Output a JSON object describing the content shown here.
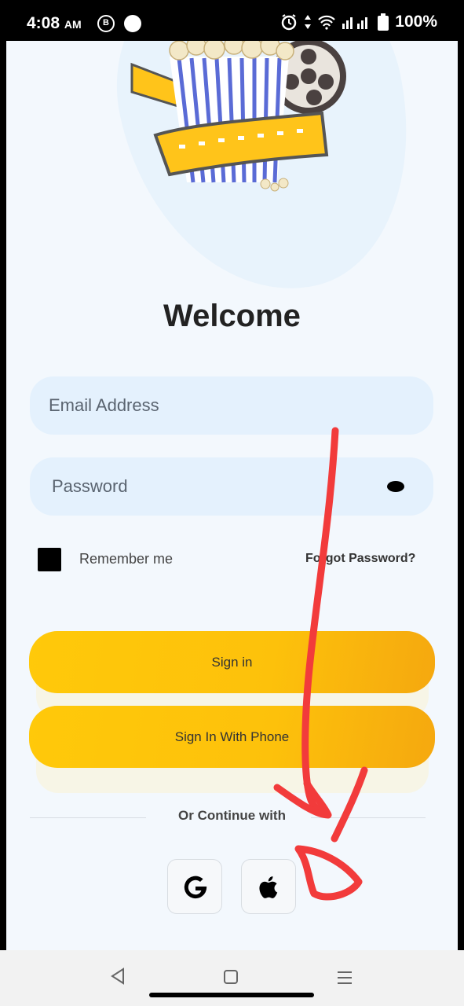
{
  "status_bar": {
    "time": "4:08",
    "ampm": "AM",
    "notification_b": "B",
    "battery": "100%"
  },
  "login": {
    "title": "Welcome",
    "email_placeholder": "Email Address",
    "password_placeholder": "Password",
    "remember_label": "Remember me",
    "forgot_label": "Forgot Password?",
    "signin_label": "Sign in",
    "phone_signin_label": "Sign In With Phone",
    "continue_label": "Or Continue with"
  },
  "social": {
    "google_icon": "google-g-icon",
    "apple_icon": "apple-logo-icon"
  },
  "colors": {
    "background": "#f3f8fd",
    "field": "#e4f1fd",
    "button": "#ffc90a",
    "button_end": "#f5a80f",
    "annotation": "#f23b3b"
  }
}
